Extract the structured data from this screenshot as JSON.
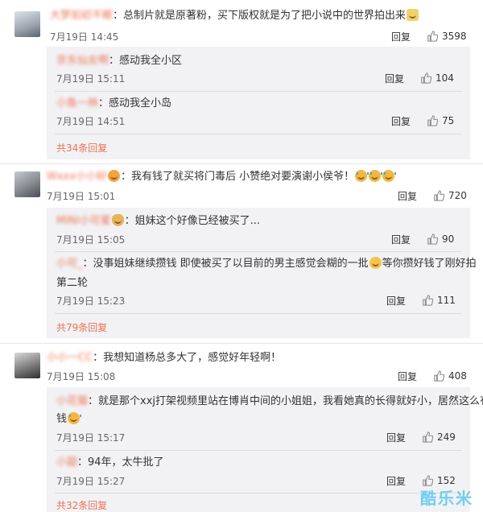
{
  "comments": [
    {
      "user": "大梦如初不眠",
      "text": "：总制片就是原著粉，买下版权就是为了把小说中的世界拍出来",
      "emoji": "cake",
      "time": "7月19日 14:45",
      "reply": "回复",
      "likes": "3598",
      "subs": [
        {
          "user": "京东仙女啊",
          "text": "：感动我全小区",
          "time": "7月19日 15:11",
          "reply": "回复",
          "likes": "104"
        },
        {
          "user": "小鱼一林",
          "text": "：感动我全小岛",
          "time": "7月19日 14:51",
          "reply": "回复",
          "likes": "75"
        }
      ],
      "more": "共34条回复"
    },
    {
      "user": "Wxxx小小好",
      "text": "：我有钱了就买将门毒后 小赞绝对要演谢小侯爷！",
      "time": "7月19日 15:01",
      "reply": "回复",
      "likes": "720",
      "subs": [
        {
          "user": "MINI小可爱",
          "text": "：姐妹这个好像已经被买了...",
          "time": "7月19日 15:05",
          "reply": "回复",
          "likes": "90"
        },
        {
          "user": "小可_",
          "text": "：没事姐妹继续攒钱 即使被买了以目前的男主感觉会糊的一批",
          "text2": "等你攒好钱了刚好拍",
          "text3": "第二轮",
          "time": "7月19日 15:23",
          "reply": "回复",
          "likes": "111"
        }
      ],
      "more": "共79条回复"
    },
    {
      "user": "小小一CC",
      "text": "：我想知道杨总多大了，感觉好年轻啊！",
      "time": "7月19日 15:08",
      "reply": "回复",
      "likes": "408",
      "subs": [
        {
          "user": "小花猫",
          "text": "：就是那个xxj打架视频里站在博肖中间的小姐姐，我看她真的长得就好小，居然这么有",
          "text2": "钱",
          "time": "7月19日 15:17",
          "reply": "回复",
          "likes": "249"
        },
        {
          "user": "小甜",
          "text": "：94年，太牛批了",
          "time": "7月19日 15:27",
          "reply": "回复",
          "likes": "152"
        }
      ],
      "more": "共32条回复"
    }
  ],
  "watermark": "酷乐米"
}
